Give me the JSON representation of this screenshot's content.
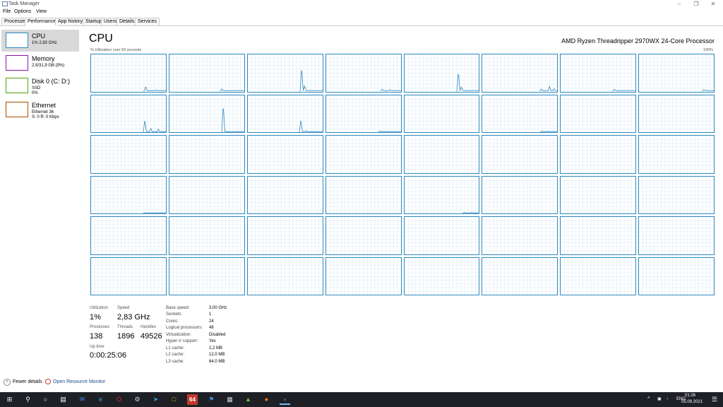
{
  "window": {
    "title": "Task Manager"
  },
  "menu": {
    "file": "File",
    "options": "Options",
    "view": "View"
  },
  "tabs": [
    "Processes",
    "Performance",
    "App history",
    "Startup",
    "Users",
    "Details",
    "Services"
  ],
  "active_tab": "Performance",
  "sidebar": {
    "items": [
      {
        "title": "CPU",
        "sub1": "1% 2,83 GHz",
        "sub2": "",
        "sub3": "",
        "color": "#2d89bf"
      },
      {
        "title": "Memory",
        "sub1": "2,9/31,9 GB (9%)",
        "sub2": "",
        "sub3": "",
        "color": "#8b12ae"
      },
      {
        "title": "Disk 0 (C: D:)",
        "sub1": "SSD",
        "sub2": "0%",
        "sub3": "",
        "color": "#4da60c"
      },
      {
        "title": "Ethernet",
        "sub1": "Ethernet 36",
        "sub2": "S: 0 R: 0 Kbps",
        "sub3": "",
        "color": "#a74f01"
      }
    ]
  },
  "main": {
    "title": "CPU",
    "model": "AMD Ryzen Threadripper 2970WX 24-Core Processor",
    "util_label": "% Utilization over 60 seconds",
    "util_max": "100%"
  },
  "stats": {
    "utilization_label": "Utilization",
    "utilization": "1%",
    "speed_label": "Speed",
    "speed": "2,83 GHz",
    "processes_label": "Processes",
    "processes": "138",
    "threads_label": "Threads",
    "threads": "1896",
    "handles_label": "Handles",
    "handles": "49526",
    "uptime_label": "Up time",
    "uptime": "0:00:25:06"
  },
  "info": [
    {
      "key": "Base speed:",
      "value": "3,00 GHz"
    },
    {
      "key": "Sockets:",
      "value": "1"
    },
    {
      "key": "Cores:",
      "value": "24"
    },
    {
      "key": "Logical processors:",
      "value": "48"
    },
    {
      "key": "Virtualization:",
      "value": "Disabled"
    },
    {
      "key": "Hyper-V support:",
      "value": "Yes"
    },
    {
      "key": "L1 cache:",
      "value": "2,2 MB"
    },
    {
      "key": "L2 cache:",
      "value": "12,0 MB"
    },
    {
      "key": "L3 cache:",
      "value": "64,0 MB"
    }
  ],
  "footer": {
    "fewer_details": "Fewer details",
    "open_monitor": "Open Resource Monitor"
  },
  "taskbar": {
    "pinned": [
      "start-icon",
      "search-icon",
      "cortana-icon",
      "task-view-icon",
      "mail-icon",
      "edge-icon",
      "opera-icon",
      "steam-icon",
      "telegram-icon",
      "file-explorer-icon",
      "aida64-icon",
      "maps-icon",
      "calculator-icon",
      "photos-icon",
      "firefox-icon",
      "task-manager-icon"
    ],
    "aida_label": "64",
    "lang": "ENG",
    "time": "01:26",
    "date": "05.09.2021"
  },
  "colors": {
    "cpu_line": "#2d89bf",
    "grid": "#d7eaf4",
    "taskbar": "#1f2026"
  },
  "cpu_graphs": {
    "rows": 6,
    "cols": 8,
    "peaks": [
      [
        [
          0.73,
          0.13
        ],
        [
          0.88,
          0.04
        ]
      ],
      [
        [
          0.7,
          0.06
        ]
      ],
      [
        [
          0.72,
          0.67
        ],
        [
          0.76,
          0.15
        ]
      ],
      [
        [
          0.75,
          0.05
        ],
        [
          0.85,
          0.04
        ]
      ],
      [
        [
          0.72,
          0.55
        ],
        [
          0.76,
          0.12
        ]
      ],
      [
        [
          0.79,
          0.06
        ],
        [
          0.9,
          0.13
        ],
        [
          0.96,
          0.07
        ]
      ],
      [
        [
          0.72,
          0.06
        ]
      ],
      [
        [
          0.87,
          0.05
        ]
      ],
      [
        [
          0.72,
          0.35
        ],
        [
          0.8,
          0.1
        ],
        [
          0.9,
          0.08
        ]
      ],
      [
        [
          0.72,
          0.77
        ]
      ],
      [
        [
          0.71,
          0.33
        ],
        [
          0.78,
          0.05
        ]
      ],
      [
        [
          0.72,
          0.03
        ]
      ],
      [],
      [
        [
          0.8,
          0.03
        ],
        [
          0.88,
          0.03
        ]
      ],
      [],
      [],
      [],
      [],
      [],
      [],
      [],
      [],
      [],
      [],
      [
        [
          0.72,
          0.02
        ]
      ],
      [],
      [],
      [],
      [
        [
          0.8,
          0.03
        ],
        [
          0.9,
          0.03
        ]
      ],
      [],
      [],
      [],
      [],
      [],
      [],
      [],
      [],
      [],
      [],
      [],
      [],
      [],
      [],
      [],
      [],
      [],
      [],
      []
    ]
  }
}
